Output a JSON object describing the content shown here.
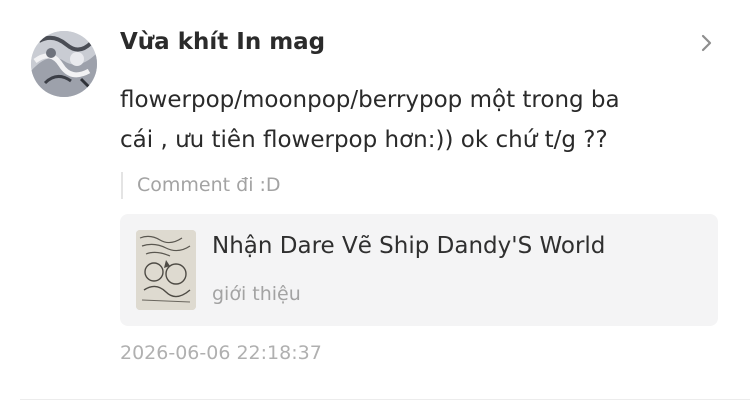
{
  "comment": {
    "username": "Vừa khít In mag",
    "text": "flowerpop/moonpop/berrypop một trong ba\ncái , ưu tiên flowerpop hơn:)) ok chứ t/g ??",
    "quote": "Comment đi :D",
    "timestamp": "2026-06-06 22:18:37"
  },
  "story_card": {
    "title": "Nhận Dare Vẽ Ship Dandy'S World",
    "subtitle": "giới thiệu"
  },
  "icons": {
    "avatar": "user-avatar",
    "chevron": "chevron-right-icon",
    "cover": "story-cover-thumbnail"
  },
  "colors": {
    "username": "#2b2b2b",
    "body_text": "#2a2a2a",
    "muted_text": "#a3a3a3",
    "card_background": "#f4f4f5"
  }
}
